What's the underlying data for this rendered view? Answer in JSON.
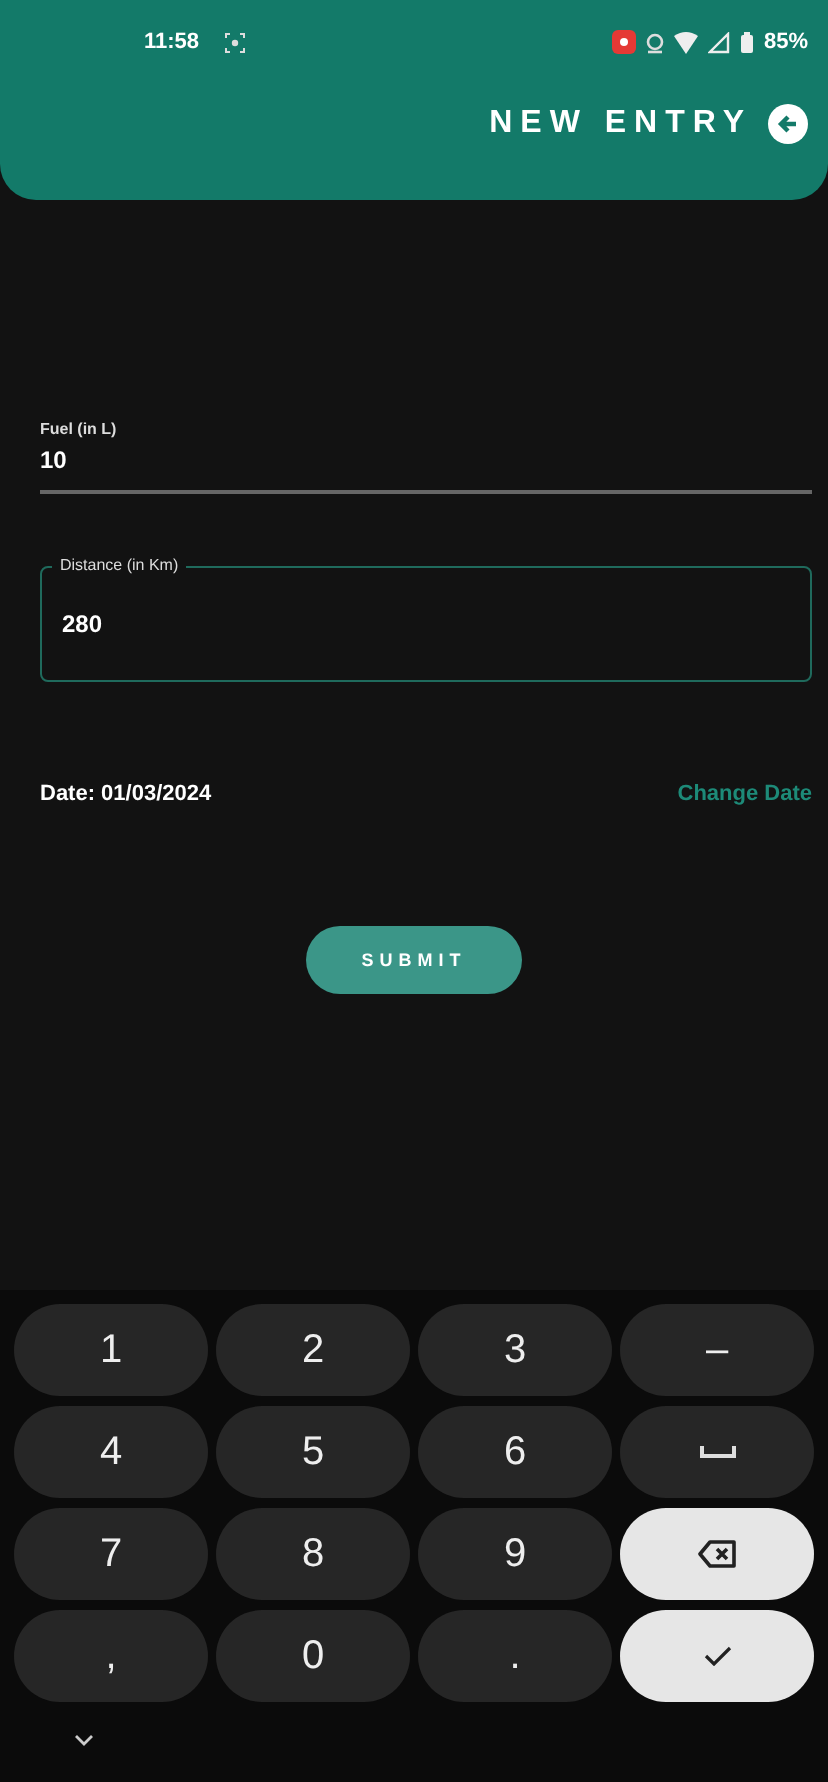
{
  "status_bar": {
    "time": "11:58",
    "battery": "85%"
  },
  "header": {
    "title": "NEW ENTRY"
  },
  "fields": [
    {
      "kind": "underline",
      "label": "Fuel (in L)",
      "value": "10",
      "focused": false
    },
    {
      "kind": "outlined",
      "label": "Distance (in Km)",
      "value": "280",
      "focused": true
    }
  ],
  "date": {
    "label": "Date: 01/03/2024",
    "action": "Change Date"
  },
  "submit": "SUBMIT",
  "keyboard": {
    "keys": [
      {
        "kind": "text",
        "label": "1"
      },
      {
        "kind": "text",
        "label": "2"
      },
      {
        "kind": "text",
        "label": "3"
      },
      {
        "kind": "text",
        "label": "–"
      },
      {
        "kind": "text",
        "label": "4"
      },
      {
        "kind": "text",
        "label": "5"
      },
      {
        "kind": "text",
        "label": "6"
      },
      {
        "kind": "space"
      },
      {
        "kind": "text",
        "label": "7"
      },
      {
        "kind": "text",
        "label": "8"
      },
      {
        "kind": "text",
        "label": "9"
      },
      {
        "kind": "backspace"
      },
      {
        "kind": "text",
        "label": ","
      },
      {
        "kind": "text",
        "label": "0"
      },
      {
        "kind": "text",
        "label": "."
      },
      {
        "kind": "enter"
      }
    ]
  }
}
